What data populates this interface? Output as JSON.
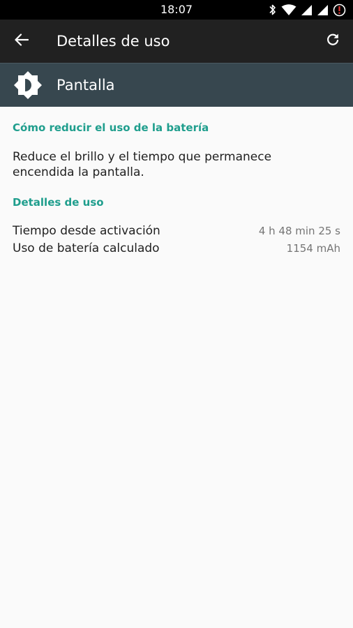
{
  "status_bar": {
    "time": "18:07",
    "icons": [
      "bluetooth-icon",
      "wifi-icon",
      "signal-icon",
      "signal-icon",
      "battery-alert-icon"
    ]
  },
  "toolbar": {
    "title": "Detalles de uso",
    "back_icon": "arrow-back-icon",
    "refresh_icon": "refresh-icon"
  },
  "app_header": {
    "name": "Pantalla",
    "icon": "brightness-icon"
  },
  "tips": {
    "title": "Cómo reducir el uso de la batería",
    "text": "Reduce el brillo y el tiempo que permanece encendida la pantalla."
  },
  "usage": {
    "title": "Detalles de uso",
    "rows": [
      {
        "label": "Tiempo desde activación",
        "value": "4 h 48 min 25 s"
      },
      {
        "label": "Uso de batería calculado",
        "value": "1154 mAh"
      }
    ]
  },
  "colors": {
    "accent": "#1f9e8d",
    "toolbar": "#212121",
    "header": "#37474f",
    "background": "#fafafa",
    "alert": "#e53935"
  }
}
